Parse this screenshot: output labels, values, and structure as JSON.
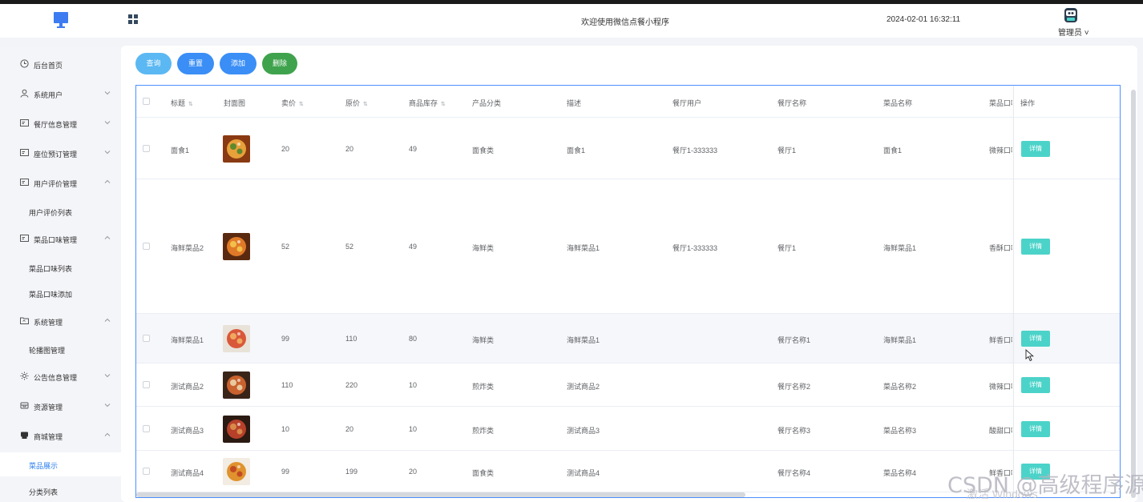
{
  "header": {
    "title": "欢迎使用微信点餐小程序",
    "datetime": "2024-02-01 16:32:11",
    "user": "管理员",
    "logo_icon": "monitor-icon",
    "menu_icon": "grid-icon"
  },
  "sidebar": {
    "items": [
      {
        "label": "后台首页",
        "icon": "clock-icon"
      },
      {
        "label": "系统用户",
        "icon": "user-icon"
      },
      {
        "label": "餐厅信息管理",
        "icon": "card-icon"
      },
      {
        "label": "座位预订管理",
        "icon": "card-icon"
      },
      {
        "label": "用户评价管理",
        "icon": "card-icon"
      },
      {
        "label": "用户评价列表"
      },
      {
        "label": "菜品口味管理",
        "icon": "card-icon"
      },
      {
        "label": "菜品口味列表"
      },
      {
        "label": "菜品口味添加"
      },
      {
        "label": "系统管理",
        "icon": "folder-icon"
      },
      {
        "label": "轮播图管理"
      },
      {
        "label": "公告信息管理",
        "icon": "sun-icon"
      },
      {
        "label": "资源管理",
        "icon": "box-icon"
      },
      {
        "label": "商城管理",
        "icon": "shop-icon"
      },
      {
        "label": "菜品展示"
      },
      {
        "label": "分类列表"
      }
    ]
  },
  "toolbar": {
    "query": "查询",
    "reset": "重置",
    "add": "添加",
    "delete": "删除"
  },
  "colors": {
    "query": "#5bb8f3",
    "reset": "#3a8ef6",
    "add": "#3a8ef6",
    "delete": "#3fa34d",
    "detail": "#4cd3c9",
    "active": "#2f80ed"
  },
  "table": {
    "headers": [
      "标题",
      "封面图",
      "卖价",
      "原价",
      "商品库存",
      "产品分类",
      "描述",
      "餐厅用户",
      "餐厅名称",
      "菜品名称",
      "菜品口味",
      "操作"
    ],
    "rows": [
      {
        "title": "面食1",
        "sell": "20",
        "orig": "20",
        "stock": "49",
        "cat": "面食类",
        "desc": "面食1",
        "user": "餐厅1-333333",
        "rname": "餐厅1",
        "dish": "面食1",
        "taste": "微辣口味",
        "op": "详情"
      },
      {
        "title": "海鲜菜品2",
        "sell": "52",
        "orig": "52",
        "stock": "49",
        "cat": "海鲜类",
        "desc": "海鲜菜品1",
        "user": "餐厅1-333333",
        "rname": "餐厅1",
        "dish": "海鲜菜品1",
        "taste": "香酥口味",
        "op": "详情"
      },
      {
        "title": "海鲜菜品1",
        "sell": "99",
        "orig": "110",
        "stock": "80",
        "cat": "海鲜类",
        "desc": "海鲜菜品1",
        "user": "",
        "rname": "餐厅名称1",
        "dish": "海鲜菜品1",
        "taste": "鲜香口味",
        "op": "详情"
      },
      {
        "title": "测试商品2",
        "sell": "110",
        "orig": "220",
        "stock": "10",
        "cat": "煎炸类",
        "desc": "测试商品2",
        "user": "",
        "rname": "餐厅名称2",
        "dish": "菜品名称2",
        "taste": "微辣口味",
        "op": "详情"
      },
      {
        "title": "测试商品3",
        "sell": "10",
        "orig": "20",
        "stock": "10",
        "cat": "煎炸类",
        "desc": "测试商品3",
        "user": "",
        "rname": "餐厅名称3",
        "dish": "菜品名称3",
        "taste": "酸甜口味",
        "op": "详情"
      },
      {
        "title": "测试商品4",
        "sell": "99",
        "orig": "199",
        "stock": "20",
        "cat": "面食类",
        "desc": "测试商品4",
        "user": "",
        "rname": "餐厅名称4",
        "dish": "菜品名称4",
        "taste": "鲜香口味",
        "op": "详情"
      }
    ]
  },
  "watermark": {
    "csdn": "CSDN @高级程序源",
    "windows": "激活 Windows"
  }
}
